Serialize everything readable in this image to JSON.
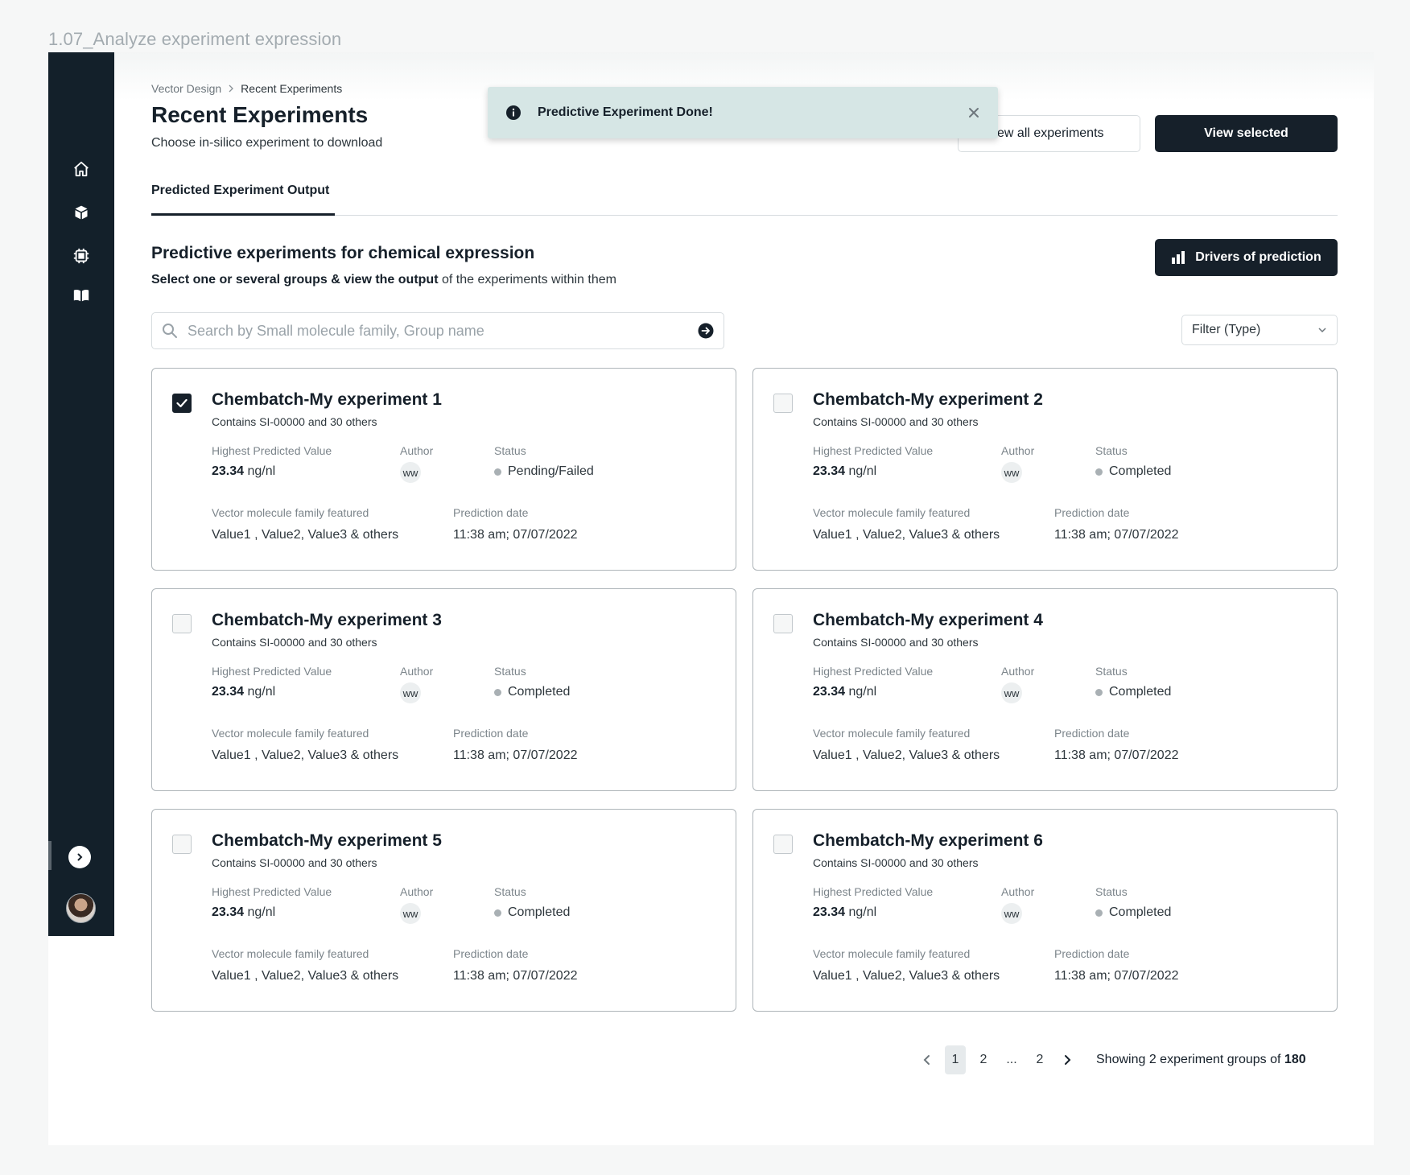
{
  "frame_title": "1.07_Analyze experiment expression",
  "breadcrumb": {
    "parent": "Vector Design",
    "current": "Recent Experiments"
  },
  "header": {
    "title": "Recent Experiments",
    "subtitle": "Choose in-silico experiment to download",
    "view_all_label": "iew all experiments",
    "view_selected_label": "View selected"
  },
  "toast": {
    "message": "Predictive Experiment Done!"
  },
  "tabs": [
    {
      "label": "Predicted  Experiment Output"
    }
  ],
  "section": {
    "title": "Predictive experiments for chemical expression",
    "subtitle_bold": "Select one or several groups & view the output",
    "subtitle_rest": " of the experiments within them",
    "drivers_label": "Drivers of prediction"
  },
  "search": {
    "placeholder": "Search by Small molecule family, Group name"
  },
  "filter": {
    "label": "Filter (Type)"
  },
  "labels": {
    "highest": "Highest Predicted Value",
    "author": "Author",
    "status": "Status",
    "family": "Vector molecule family featured",
    "date": "Prediction date"
  },
  "cards": [
    {
      "title": "Chembatch-My experiment 1",
      "subtitle": "Contains SI-00000 and 30 others",
      "value_num": "23.34",
      "value_unit": " ng/nl",
      "author": "ww",
      "status": "Pending/Failed",
      "family": "Value1 , Value2, Value3 & others",
      "date": "11:38 am; 07/07/2022",
      "checked": true
    },
    {
      "title": "Chembatch-My experiment 2",
      "subtitle": "Contains SI-00000 and 30 others",
      "value_num": "23.34",
      "value_unit": " ng/nl",
      "author": "ww",
      "status": "Completed",
      "family": "Value1 , Value2, Value3 & others",
      "date": "11:38 am; 07/07/2022",
      "checked": false
    },
    {
      "title": "Chembatch-My experiment 3",
      "subtitle": "Contains SI-00000 and 30 others",
      "value_num": "23.34",
      "value_unit": " ng/nl",
      "author": "ww",
      "status": "Completed",
      "family": "Value1 , Value2, Value3 & others",
      "date": "11:38 am; 07/07/2022",
      "checked": false
    },
    {
      "title": "Chembatch-My experiment 4",
      "subtitle": "Contains SI-00000 and 30 others",
      "value_num": "23.34",
      "value_unit": " ng/nl",
      "author": "ww",
      "status": "Completed",
      "family": "Value1 , Value2, Value3 & others",
      "date": "11:38 am; 07/07/2022",
      "checked": false
    },
    {
      "title": "Chembatch-My experiment 5",
      "subtitle": "Contains SI-00000 and 30 others",
      "value_num": "23.34",
      "value_unit": " ng/nl",
      "author": "ww",
      "status": "Completed",
      "family": "Value1 , Value2, Value3 & others",
      "date": "11:38 am; 07/07/2022",
      "checked": false
    },
    {
      "title": "Chembatch-My experiment 6",
      "subtitle": "Contains SI-00000 and 30 others",
      "value_num": "23.34",
      "value_unit": " ng/nl",
      "author": "ww",
      "status": "Completed",
      "family": "Value1 , Value2, Value3 & others",
      "date": "11:38 am; 07/07/2022",
      "checked": false
    }
  ],
  "pagination": {
    "pages": [
      "1",
      "2",
      "...",
      "2"
    ],
    "active_page": "1",
    "showing_text": "Showing 2 experiment groups of ",
    "total": "180"
  },
  "sidebar": {
    "icons": [
      "home-icon",
      "cube-icon",
      "chip-icon",
      "book-icon"
    ]
  }
}
